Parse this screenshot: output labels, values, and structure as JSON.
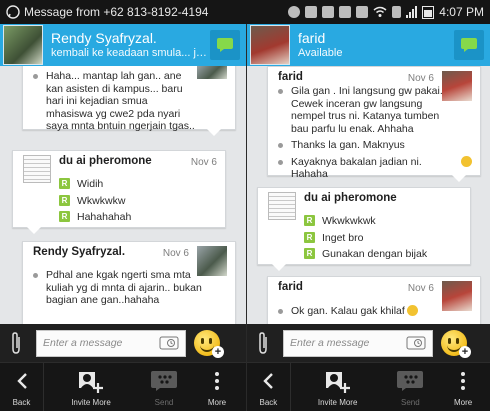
{
  "status_bar": {
    "notification": "Message from +62 813-8192-4194",
    "time": "4:07 PM"
  },
  "left": {
    "header": {
      "name": "Rendy Syafryzal.",
      "status": "kembali ke keadaan smula... jalani..."
    },
    "messages": [
      {
        "sender": "",
        "date": "",
        "lines": [
          "Haha... mantap lah gan.. ane kan asisten di kampus... baru hari ini kejadian smua mhasiswa yg cwe2 pda nyari saya mnta bntuin ngerjain tgas.."
        ]
      },
      {
        "sender": "du ai pheromone",
        "date": "Nov 6",
        "lines": [
          "Widih",
          "Wkwkwkw",
          "Hahahahah"
        ]
      },
      {
        "sender": "Rendy Syafryzal.",
        "date": "Nov 6",
        "lines": [
          "Pdhal ane kgak ngerti sma mta kuliah yg di mnta di ajarin.. bukan bagian ane gan..hahaha"
        ]
      }
    ],
    "input_placeholder": "Enter a message"
  },
  "right": {
    "header": {
      "name": "farid",
      "status": "Available"
    },
    "messages": [
      {
        "sender": "farid",
        "date": "Nov 6",
        "lines": [
          "Gila gan . Ini langsung gw pakai. Cewek inceran gw langsung nempel trus ni. Katanya tumben bau parfu lu enak. Ahhaha",
          "Thanks la gan. Maknyus",
          "Kayaknya bakalan jadian ni. Hahaha"
        ]
      },
      {
        "sender": "du ai pheromone",
        "date": "Nov 6",
        "lines": [
          "Wkwkwkwk",
          "Inget bro",
          "Gunakan dengan bijak"
        ]
      },
      {
        "sender": "farid",
        "date": "Nov 6",
        "lines": [
          "Ok gan. Kalau gak khilaf"
        ]
      }
    ],
    "input_placeholder": "Enter a message"
  },
  "toolbar": {
    "back": "Back",
    "invite": "Invite More",
    "send": "Send",
    "more": "More"
  },
  "colors": {
    "header": "#29a9e1",
    "read_marker": "#8cc63f",
    "toolbar": "#161616"
  }
}
